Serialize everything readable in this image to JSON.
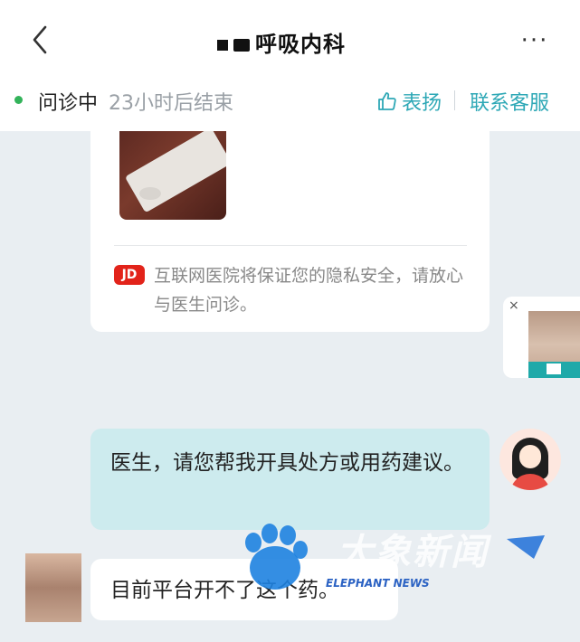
{
  "header": {
    "title": "呼吸内科",
    "more_label": "···",
    "status": "问诊中",
    "status_sub": "23小时后结束",
    "praise_label": "表扬",
    "contact_label": "联系客服"
  },
  "card": {
    "jd_badge": "JD",
    "privacy_text": "互联网医院将保证您的隐私安全，请放心与医生问诊。"
  },
  "float_widget": {
    "close_label": "×"
  },
  "messages": [
    {
      "side": "right",
      "text": "医生，请您帮我开具处方或用药建议。"
    },
    {
      "side": "left",
      "text": "目前平台开不了这个药。"
    }
  ],
  "watermark": {
    "cn": "大象新闻",
    "en": "ELEPHANT NEWS"
  },
  "colors": {
    "accent": "#2ea8b6",
    "status_green": "#33b35a",
    "bubble_right": "#cdebee",
    "jd_red": "#e2231a"
  }
}
